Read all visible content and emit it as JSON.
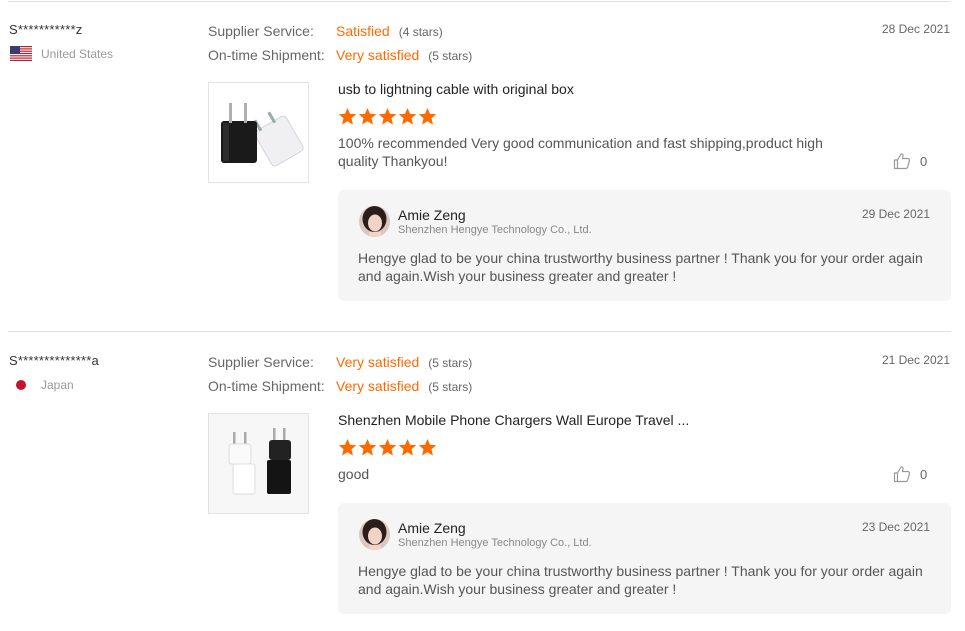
{
  "reviews": [
    {
      "user": "S***********z",
      "country": "United States",
      "supplier_service_label": "Supplier Service:",
      "supplier_service_value": "Satisfied",
      "supplier_service_stars": "(4 stars)",
      "shipment_label": "On-time Shipment:",
      "shipment_value": "Very satisfied",
      "shipment_stars": "(5 stars)",
      "date": "28 Dec 2021",
      "product_title": "usb to lightning cable with original box",
      "rating": 5,
      "text": "100% recommended  Very good communication and fast shipping,product high quality Thankyou!",
      "likes": "0",
      "reply": {
        "name": "Amie Zeng",
        "company": "Shenzhen Hengye Technology Co., Ltd.",
        "date": "29 Dec 2021",
        "text": "Hengye glad to be your china trustworthy business partner ! Thank you for your order again and again.Wish your business greater and greater !"
      }
    },
    {
      "user": "S**************a",
      "country": "Japan",
      "supplier_service_label": "Supplier Service:",
      "supplier_service_value": "Very satisfied",
      "supplier_service_stars": "(5 stars)",
      "shipment_label": "On-time Shipment:",
      "shipment_value": "Very satisfied",
      "shipment_stars": "(5 stars)",
      "date": "21 Dec 2021",
      "product_title": "Shenzhen Mobile Phone Chargers Wall Europe Travel ...",
      "rating": 5,
      "text": "good",
      "likes": "0",
      "reply": {
        "name": "Amie Zeng",
        "company": "Shenzhen Hengye Technology Co., Ltd.",
        "date": "23 Dec 2021",
        "text": "Hengye glad to be your china trustworthy business partner ! Thank you for your order again and again.Wish your business greater and greater !"
      }
    }
  ],
  "colors": {
    "accent": "#ff6a00",
    "reply_bg": "#f5f5f5"
  },
  "icons": {
    "like": "thumbs-up-icon",
    "star": "star-icon"
  }
}
